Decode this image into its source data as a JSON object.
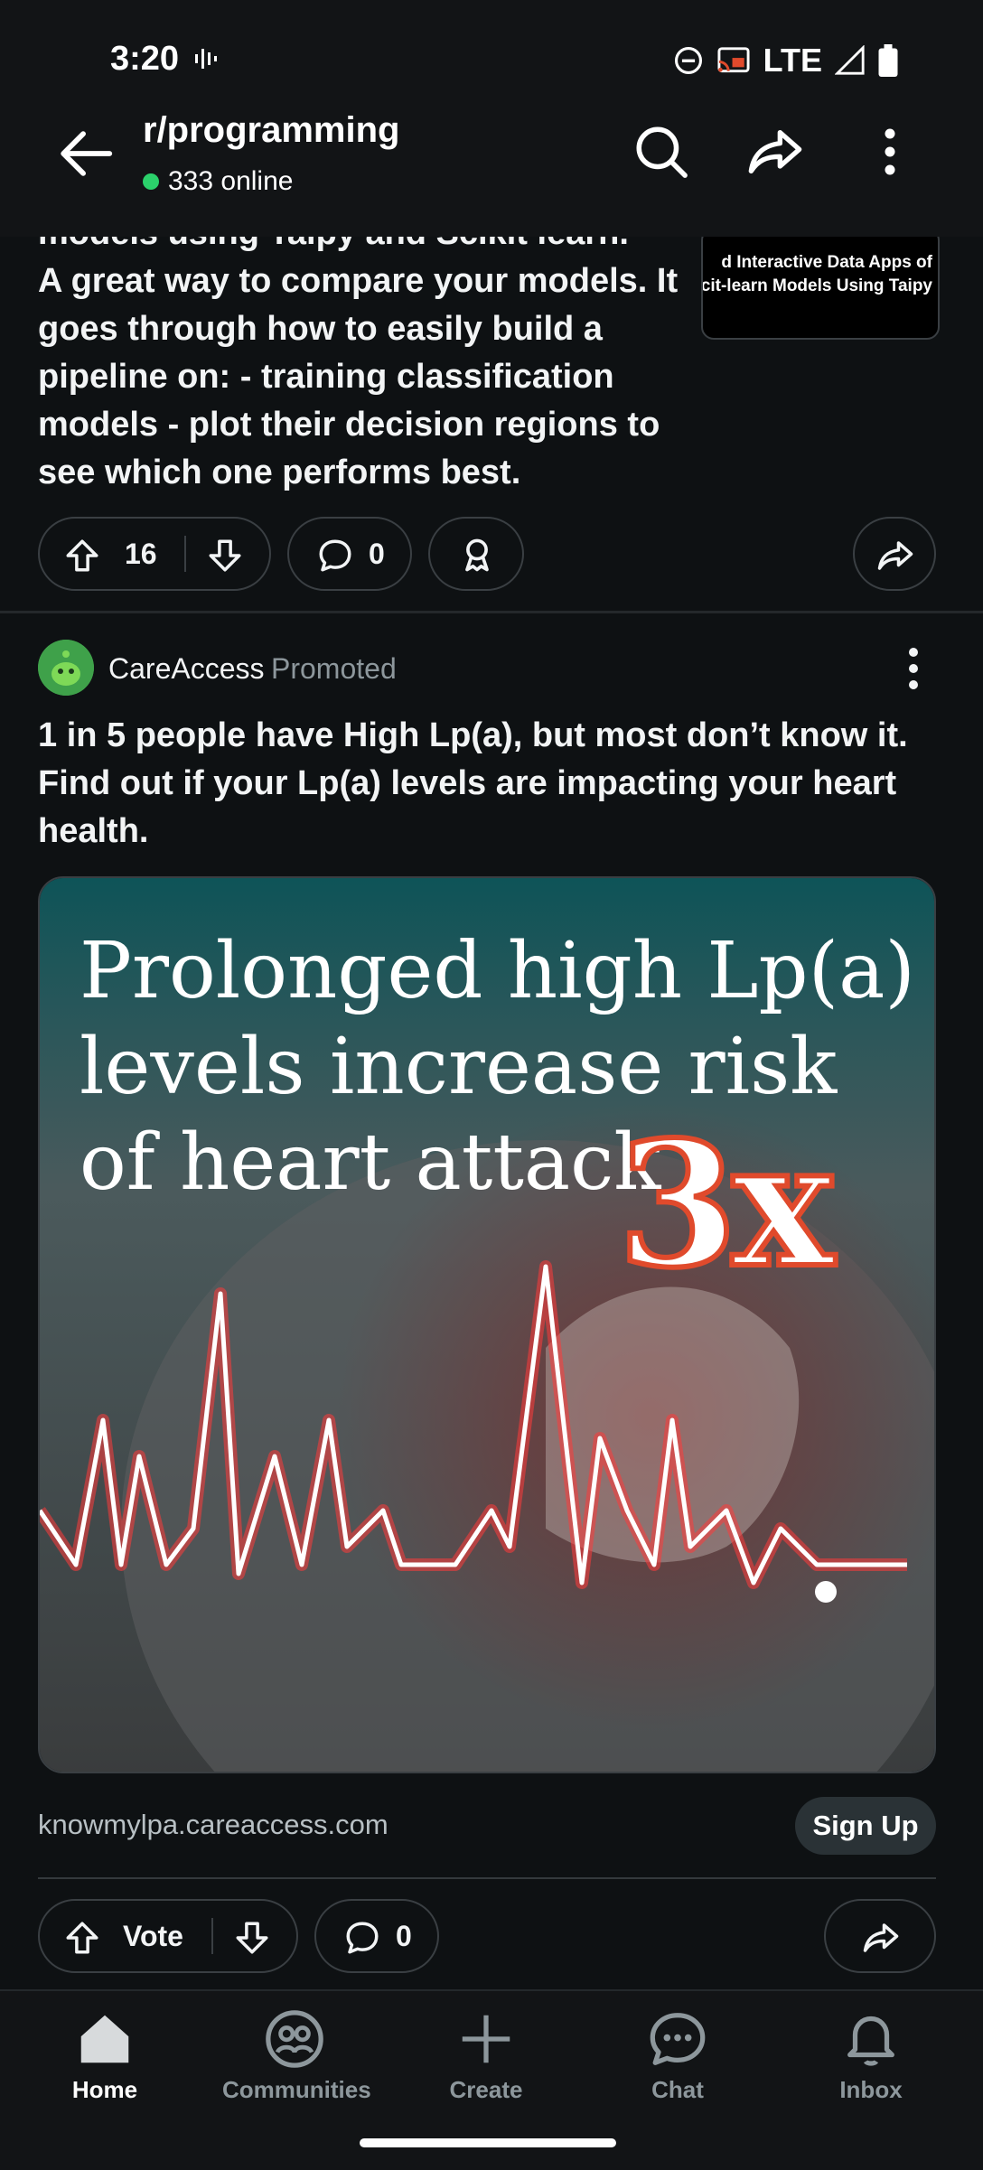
{
  "status_bar": {
    "time": "3:20",
    "network": "LTE"
  },
  "header": {
    "title": "r/programming",
    "online": "333 online"
  },
  "post1": {
    "text_top": "models using Taipy and Scikit learn.",
    "text": "A great way to compare your models. It goes through how to easily build a pipeline on: - training classification models - plot their decision regions to see which one performs best.",
    "thumbnail_line1": "d Interactive Data Apps of",
    "thumbnail_line2": "cit-learn Models Using Taipy",
    "votes": "16",
    "comments": "0"
  },
  "ad": {
    "advertiser": "CareAccess",
    "promoted_label": "Promoted",
    "title": "1 in 5 people have High Lp(a), but most don’t know it. Find out if your Lp(a) levels are impacting your heart health.",
    "image_headline": "Prolonged high Lp(a)\nlevels increase risk\nof heart attack",
    "image_highlight": "3x",
    "domain": "knowmylpa.careaccess.com",
    "cta": "Sign Up",
    "vote_label": "Vote",
    "comments": "0"
  },
  "nav": {
    "items": [
      {
        "label": "Home",
        "icon": "home-icon",
        "active": true
      },
      {
        "label": "Communities",
        "icon": "communities-icon",
        "active": false
      },
      {
        "label": "Create",
        "icon": "plus-icon",
        "active": false
      },
      {
        "label": "Chat",
        "icon": "chat-icon",
        "active": false
      },
      {
        "label": "Inbox",
        "icon": "bell-icon",
        "active": false
      }
    ]
  },
  "colors": {
    "background": "#0e1113",
    "online": "#2bd16b",
    "accent_red": "#e04a2c"
  }
}
